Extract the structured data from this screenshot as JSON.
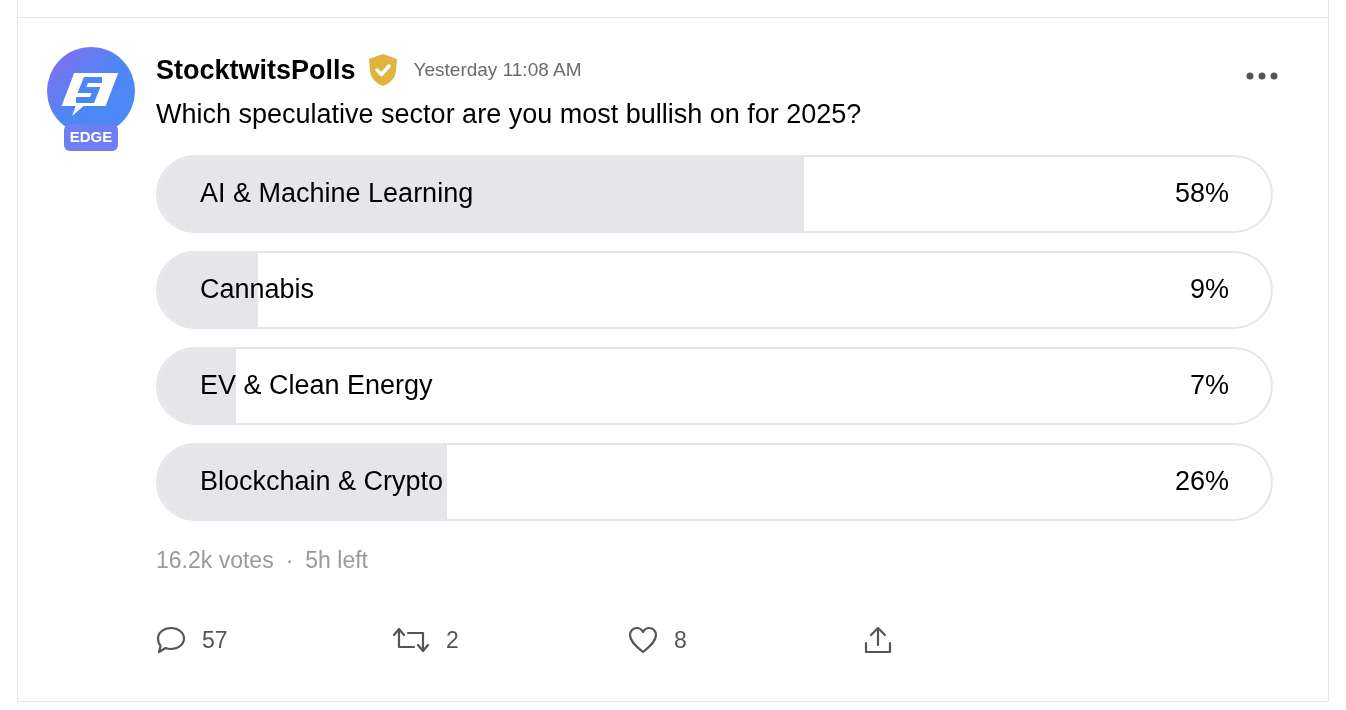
{
  "post": {
    "author": "StocktwitsPolls",
    "verified": true,
    "badge": "EDGE",
    "time": "Yesterday 11:08 AM",
    "question": "Which speculative sector are you most bullish on for 2025?"
  },
  "poll": {
    "options": [
      {
        "label": "AI & Machine Learning",
        "percent": "58%",
        "level": 0.58
      },
      {
        "label": "Cannabis",
        "percent": "9%",
        "level": 0.09
      },
      {
        "label": "EV & Clean Energy",
        "percent": "7%",
        "level": 0.07
      },
      {
        "label": "Blockchain & Crypto",
        "percent": "26%",
        "level": 0.26
      }
    ],
    "votes": "16.2k votes",
    "separator": "·",
    "time_left": "5h left"
  },
  "actions": [
    {
      "kind": "comment",
      "count": "57"
    },
    {
      "kind": "repost",
      "count": "2"
    },
    {
      "kind": "like",
      "count": "8"
    },
    {
      "kind": "share"
    }
  ]
}
